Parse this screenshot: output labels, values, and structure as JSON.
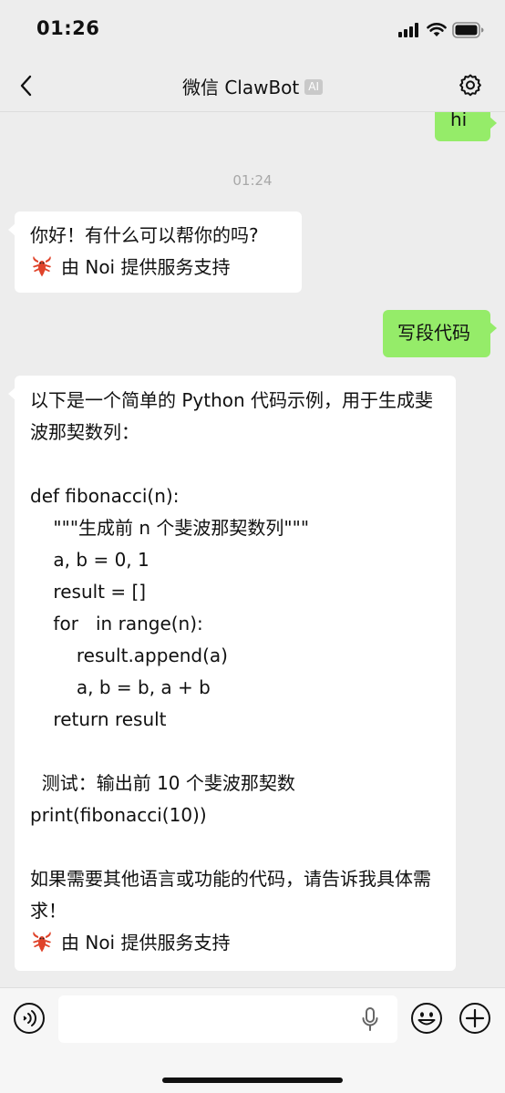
{
  "status_bar": {
    "time": "01:26",
    "icons": [
      "signal-icon",
      "wifi-icon",
      "battery-icon"
    ]
  },
  "nav": {
    "title": "微信 ClawBot",
    "badge": "AI",
    "icons": [
      "back-icon",
      "gear-icon"
    ]
  },
  "messages": {
    "hi": "hi",
    "timestamp": "01:24",
    "greeting": {
      "line1": "你好！有什么可以帮你的吗?",
      "footer_icon": "lobster-icon",
      "footer": "由 Noi 提供服务支持"
    },
    "request": "写段代码",
    "code_reply": {
      "intro": "以下是一个简单的 Python 代码示例，用于生成斐波那契数列：",
      "code_lines": [
        "def fibonacci(n):",
        "    \"\"\"生成前 n 个斐波那契数列\"\"\"",
        "    a, b = 0, 1",
        "    result = []",
        "    for   in range(n):",
        "        result.append(a)",
        "        a, b = b, a + b",
        "    return result"
      ],
      "test_comment": "  测试：输出前 10 个斐波那契数",
      "print_line": "print(fibonacci(10))",
      "outro": "如果需要其他语言或功能的代码，请告诉我具体需求！",
      "footer_icon": "lobster-icon",
      "footer": "由 Noi 提供服务支持"
    }
  },
  "input_bar": {
    "placeholder": "",
    "icons": [
      "voice-icon",
      "mic-icon",
      "emoji-icon",
      "plus-icon"
    ]
  },
  "colors": {
    "background": "#ededed",
    "incoming_bubble": "#ffffff",
    "outgoing_bubble": "#95ec69",
    "timestamp": "#a8a8a8"
  }
}
